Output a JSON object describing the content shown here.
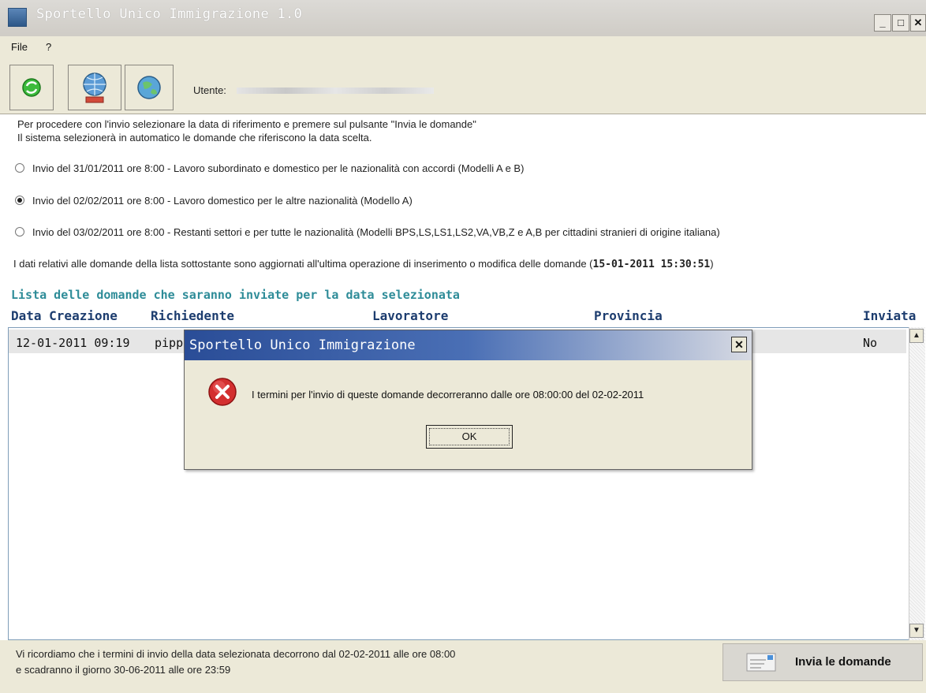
{
  "window": {
    "title": "Sportello Unico Immigrazione 1.0",
    "minimize_label": "_",
    "maximize_label": "□",
    "close_label": "✕"
  },
  "menu": {
    "items": [
      {
        "label": "File"
      },
      {
        "label": "?"
      }
    ]
  },
  "toolbar": {
    "user_label": "Utente:"
  },
  "instructions": {
    "line1": "Per procedere con l'invio selezionare la data di riferimento e premere sul pulsante \"Invia le domande\"",
    "line2": "Il sistema selezionerà in automatico le domande che riferiscono la data scelta."
  },
  "options": [
    {
      "label": "Invio del 31/01/2011 ore 8:00 - Lavoro subordinato e domestico per le nazionalità con accordi (Modelli A e B)",
      "selected": false
    },
    {
      "label": "Invio del 02/02/2011 ore 8:00 - Lavoro domestico per le altre nazionalità (Modello A)",
      "selected": true
    },
    {
      "label": "Invio del 03/02/2011 ore 8:00 - Restanti settori e per tutte le nazionalità (Modelli BPS,LS,LS1,LS2,VA,VB,Z e A,B per cittadini stranieri di origine italiana)",
      "selected": false
    }
  ],
  "update_note": {
    "prefix": "I dati relativi alle domande della lista sottostante sono aggiornati all'ultima operazione di inserimento o modifica delle domande (",
    "timestamp": "15-01-2011 15:30:51",
    "suffix": ")"
  },
  "list": {
    "title": "Lista delle domande che saranno inviate per la data selezionata",
    "columns": [
      "Data Creazione",
      "Richiedente",
      "Lavoratore",
      "Provincia",
      "Inviata"
    ],
    "rows": [
      {
        "data_creazione": "12-01-2011 09:19",
        "richiedente": "pippo",
        "inviata": "No"
      }
    ]
  },
  "footer": {
    "line1": "Vi ricordiamo che i termini di invio della data selezionata decorrono dal 02-02-2011 alle ore 08:00",
    "line2": "e scadranno il giorno 30-06-2011 alle ore 23:59",
    "send_button": "Invia le domande"
  },
  "dialog": {
    "title": "Sportello Unico Immigrazione",
    "message": "I termini per l'invio di queste domande decorreranno dalle ore 08:00:00 del 02-02-2011",
    "ok_label": "OK",
    "close_label": "✕"
  },
  "colors": {
    "title_bar": "#d4d0c8",
    "dialog_title_start": "#2a4d97",
    "list_title": "#2e8c98",
    "column_header": "#1d3d6f",
    "error_red": "#c62828"
  },
  "icons": [
    "refresh-icon",
    "globe-network-icon",
    "globe-arrow-icon",
    "error-icon",
    "send-mail-icon"
  ]
}
